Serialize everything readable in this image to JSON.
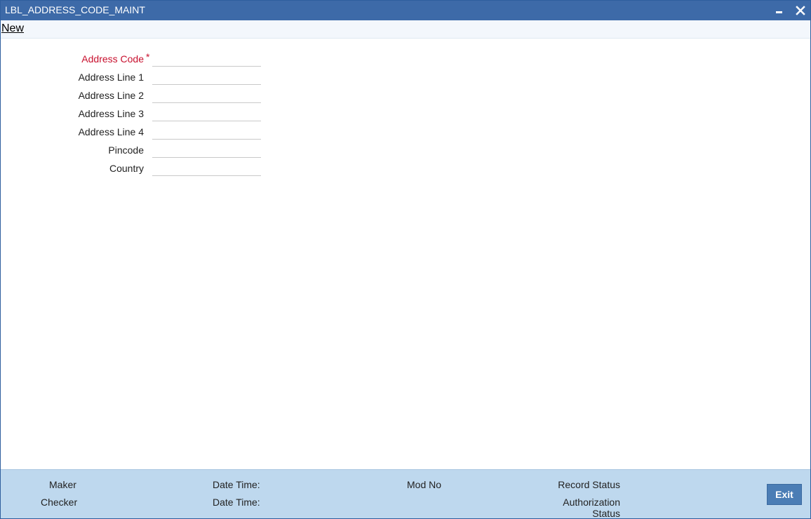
{
  "window": {
    "title": "LBL_ADDRESS_CODE_MAINT"
  },
  "toolbar": {
    "new_label": "New"
  },
  "form": {
    "fields": [
      {
        "label": "Address Code",
        "required_mark": "*",
        "value": ""
      },
      {
        "label": "Address Line 1",
        "value": ""
      },
      {
        "label": "Address Line 2",
        "value": ""
      },
      {
        "label": "Address Line 3",
        "value": ""
      },
      {
        "label": "Address Line 4",
        "value": ""
      },
      {
        "label": "Pincode",
        "value": ""
      },
      {
        "label": "Country",
        "value": ""
      }
    ]
  },
  "footer": {
    "maker_label": "Maker",
    "checker_label": "Checker",
    "maker_datetime_label": "Date Time:",
    "checker_datetime_label": "Date Time:",
    "mod_no_label": "Mod No",
    "record_status_label": "Record Status",
    "authorization_label_line1": "Authorization",
    "authorization_label_line2": "Status",
    "exit_label": "Exit"
  },
  "colors": {
    "titlebar": "#3d6aa8",
    "footer": "#bed8ee",
    "required": "#c8102e",
    "exit_button": "#4b7db5"
  }
}
